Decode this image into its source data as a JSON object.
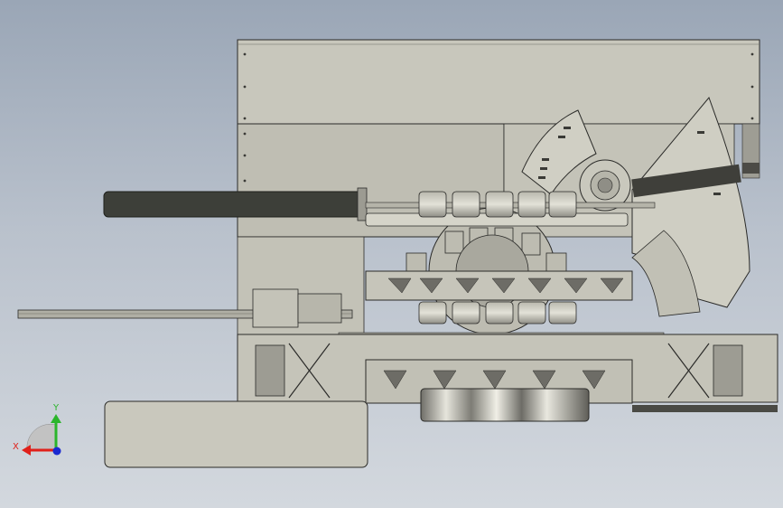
{
  "viewport": {
    "background_top": "#9aa6b6",
    "background_bottom": "#d3d8de"
  },
  "model": {
    "metal_color": "#c9c8bd",
    "metal_dark": "#8d8c84",
    "edge_color": "#2a2a28",
    "shadow_color": "#5b5b55",
    "roller_color": "#d4d3c9",
    "barrel_color": "#3d3f39"
  },
  "triad": {
    "x_label": "X",
    "y_label": "Y",
    "x_color": "#e0201a",
    "y_color": "#2bb52b",
    "z_color": "#1a2ad0"
  }
}
